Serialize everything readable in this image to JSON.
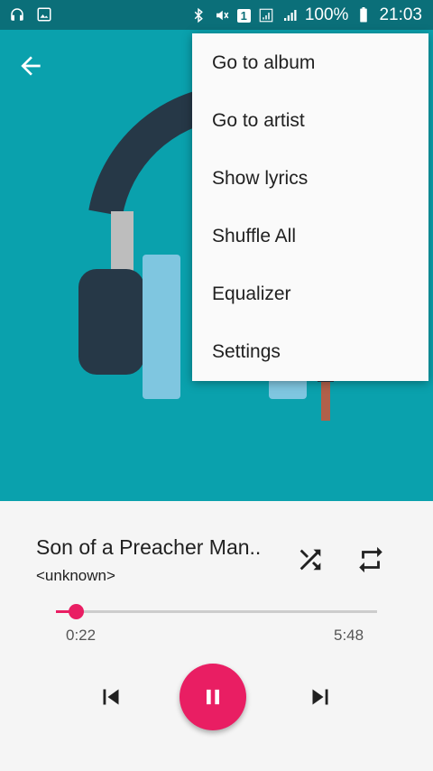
{
  "status_bar": {
    "battery": "100%",
    "time": "21:03",
    "sim_slot": "1"
  },
  "menu": {
    "items": [
      "Go to album",
      "Go to artist",
      "Show lyrics",
      "Shuffle All",
      "Equalizer",
      "Settings"
    ]
  },
  "player": {
    "song_title": "Son of a Preacher Man..",
    "artist": "<unknown>",
    "elapsed": "0:22",
    "duration": "5:48",
    "progress_fraction": 0.063
  },
  "colors": {
    "accent": "#e91e63",
    "art_background": "#0aa1ad",
    "status_bar": "#0b6f79"
  }
}
